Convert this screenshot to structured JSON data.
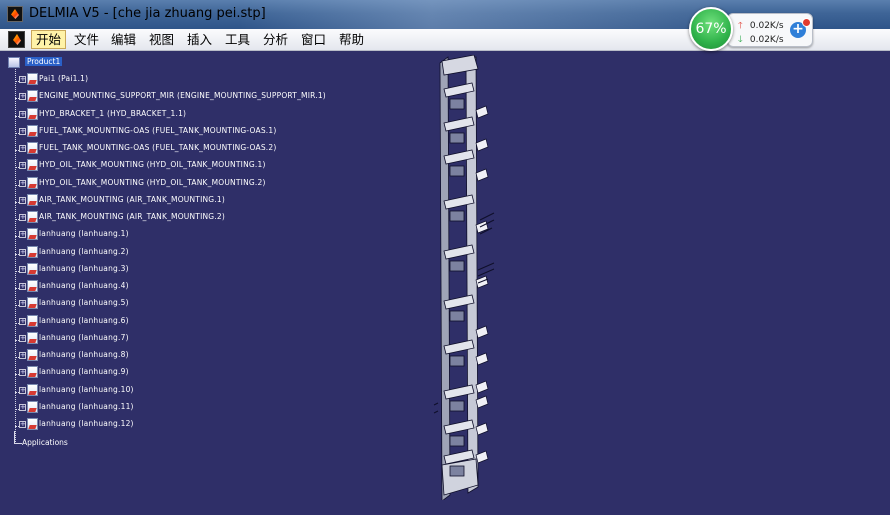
{
  "window": {
    "app_name": "DELMIA V5",
    "document": "che jia zhuang pei.stp",
    "title": "DELMIA V5 - [che jia zhuang pei.stp]"
  },
  "menu": {
    "items": [
      "开始",
      "文件",
      "编辑",
      "视图",
      "插入",
      "工具",
      "分析",
      "窗口",
      "帮助"
    ],
    "active_index": 0
  },
  "network": {
    "percent": "67%",
    "upload": "0.02K/s",
    "download": "0.02K/s",
    "plus": "+"
  },
  "tree": {
    "root": "Product1",
    "nodes": [
      "Pai1 (Pai1.1)",
      "ENGINE_MOUNTING_SUPPORT_MIR (ENGINE_MOUNTING_SUPPORT_MIR.1)",
      "HYD_BRACKET_1 (HYD_BRACKET_1.1)",
      "FUEL_TANK_MOUNTING-OAS (FUEL_TANK_MOUNTING-OAS.1)",
      "FUEL_TANK_MOUNTING-OAS (FUEL_TANK_MOUNTING-OAS.2)",
      "HYD_OIL_TANK_MOUNTING (HYD_OIL_TANK_MOUNTING.1)",
      "HYD_OIL_TANK_MOUNTING (HYD_OIL_TANK_MOUNTING.2)",
      "AIR_TANK_MOUNTING (AIR_TANK_MOUNTING.1)",
      "AIR_TANK_MOUNTING (AIR_TANK_MOUNTING.2)",
      "lanhuang (lanhuang.1)",
      "lanhuang (lanhuang.2)",
      "lanhuang (lanhuang.3)",
      "lanhuang (lanhuang.4)",
      "lanhuang (lanhuang.5)",
      "lanhuang (lanhuang.6)",
      "lanhuang (lanhuang.7)",
      "lanhuang (lanhuang.8)",
      "lanhuang (lanhuang.9)",
      "lanhuang (lanhuang.10)",
      "lanhuang (lanhuang.11)",
      "lanhuang (lanhuang.12)"
    ],
    "applications": "Applications"
  },
  "colors": {
    "viewport_bg": "#2f2f68",
    "titlebar": "#3f6597",
    "selection": "#2a60c8",
    "tree_text": "#ffffff",
    "net_green": "#2fb24a"
  }
}
